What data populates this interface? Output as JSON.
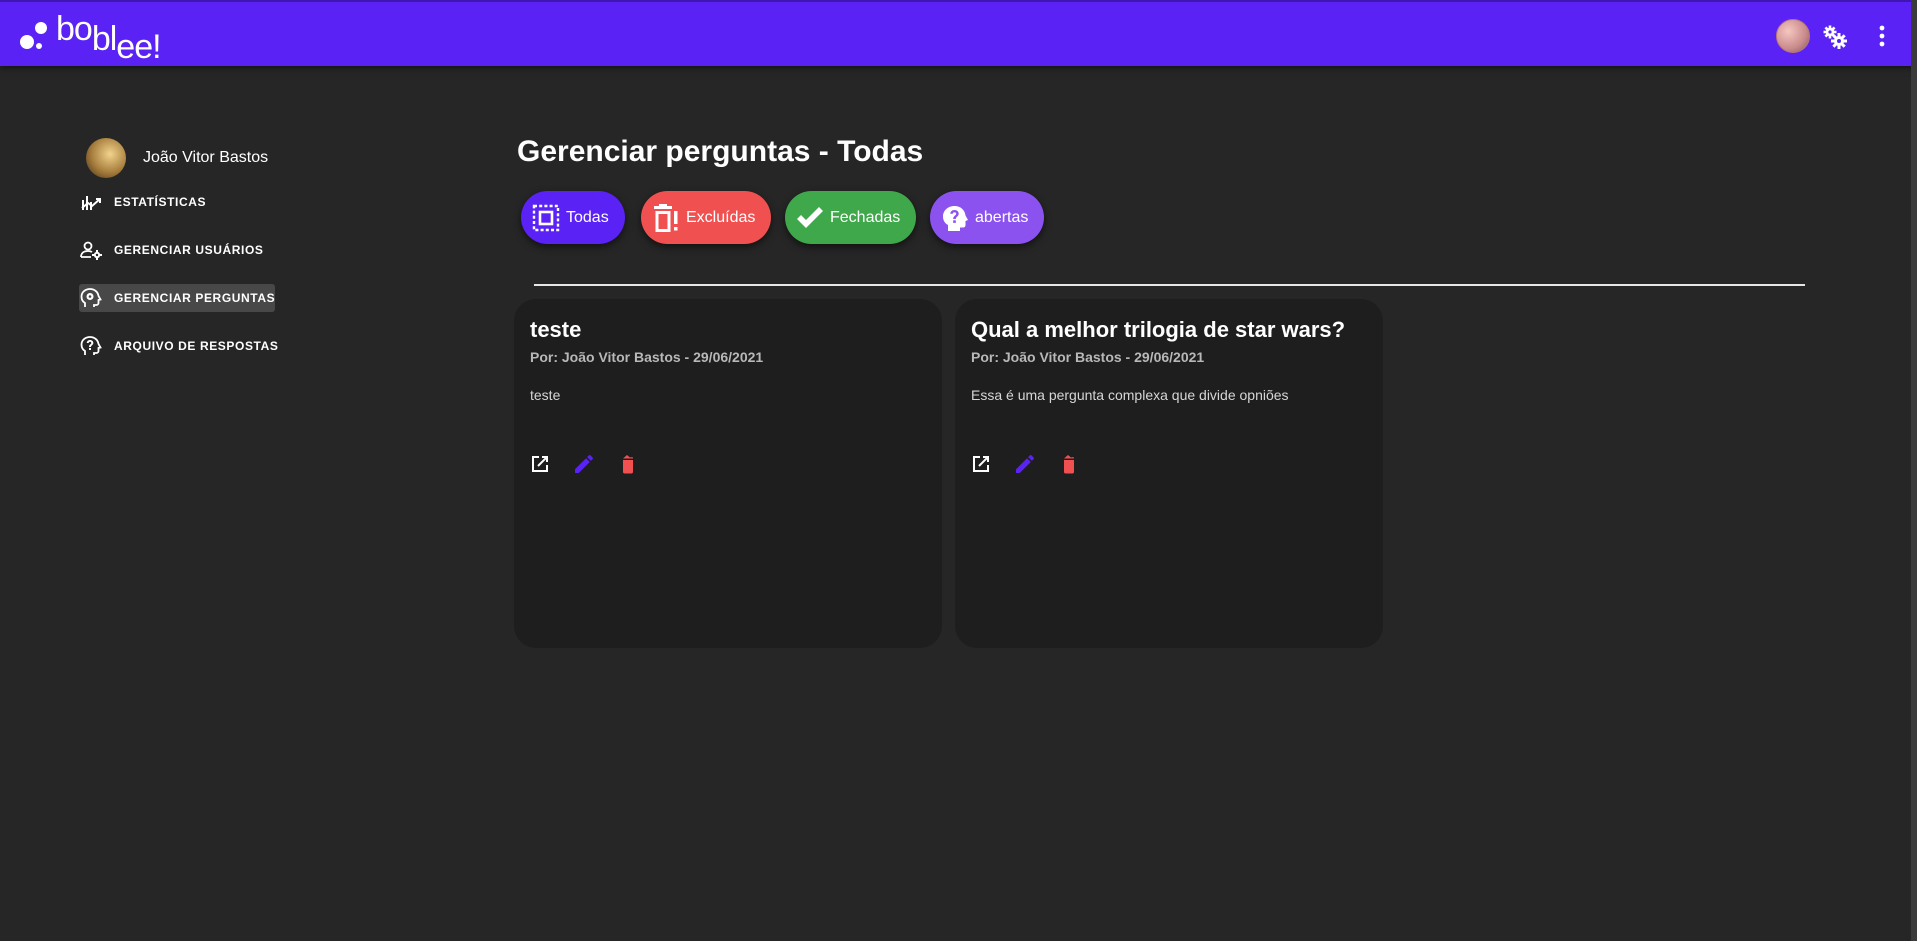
{
  "app": {
    "logo_text": [
      "bo",
      "bl",
      "ee!"
    ]
  },
  "topbar": {
    "avatar_icon": "user-avatar",
    "settings_icon": "gears-icon",
    "menu_icon": "more-vert-icon"
  },
  "sidebar": {
    "user_name": "João Vitor Bastos",
    "items": [
      {
        "label": "ESTATÍSTICAS",
        "icon": "stats-icon",
        "active": false
      },
      {
        "label": "GERENCIAR USUÁRIOS",
        "icon": "manage-users-icon",
        "active": false
      },
      {
        "label": "GERENCIAR PERGUNTAS",
        "icon": "manage-questions-icon",
        "active": true
      },
      {
        "label": "ARQUIVO DE RESPOSTAS",
        "icon": "answers-archive-icon",
        "active": false
      }
    ]
  },
  "main": {
    "title": "Gerenciar perguntas - Todas",
    "filters": [
      {
        "label": "Todas",
        "icon": "select-all-icon",
        "color": "#5a22f5"
      },
      {
        "label": "Excluídas",
        "icon": "trash-alert-icon",
        "color": "#f05050"
      },
      {
        "label": "Fechadas",
        "icon": "check-icon",
        "color": "#3fa84a"
      },
      {
        "label": "abertas",
        "icon": "question-head-icon",
        "color": "#8b52f0"
      }
    ],
    "cards": [
      {
        "title": "teste",
        "meta": "Por: João Vitor Bastos - 29/06/2021",
        "body": "teste"
      },
      {
        "title": "Qual a melhor trilogia de star wars?",
        "meta": "Por: João Vitor Bastos - 29/06/2021",
        "body": "Essa é uma pergunta complexa que divide opniões"
      }
    ]
  },
  "colors": {
    "topbar": "#5a22f5",
    "background": "#262626",
    "card": "#1e1e1e",
    "edit": "#5a22f5",
    "delete": "#f05050"
  }
}
